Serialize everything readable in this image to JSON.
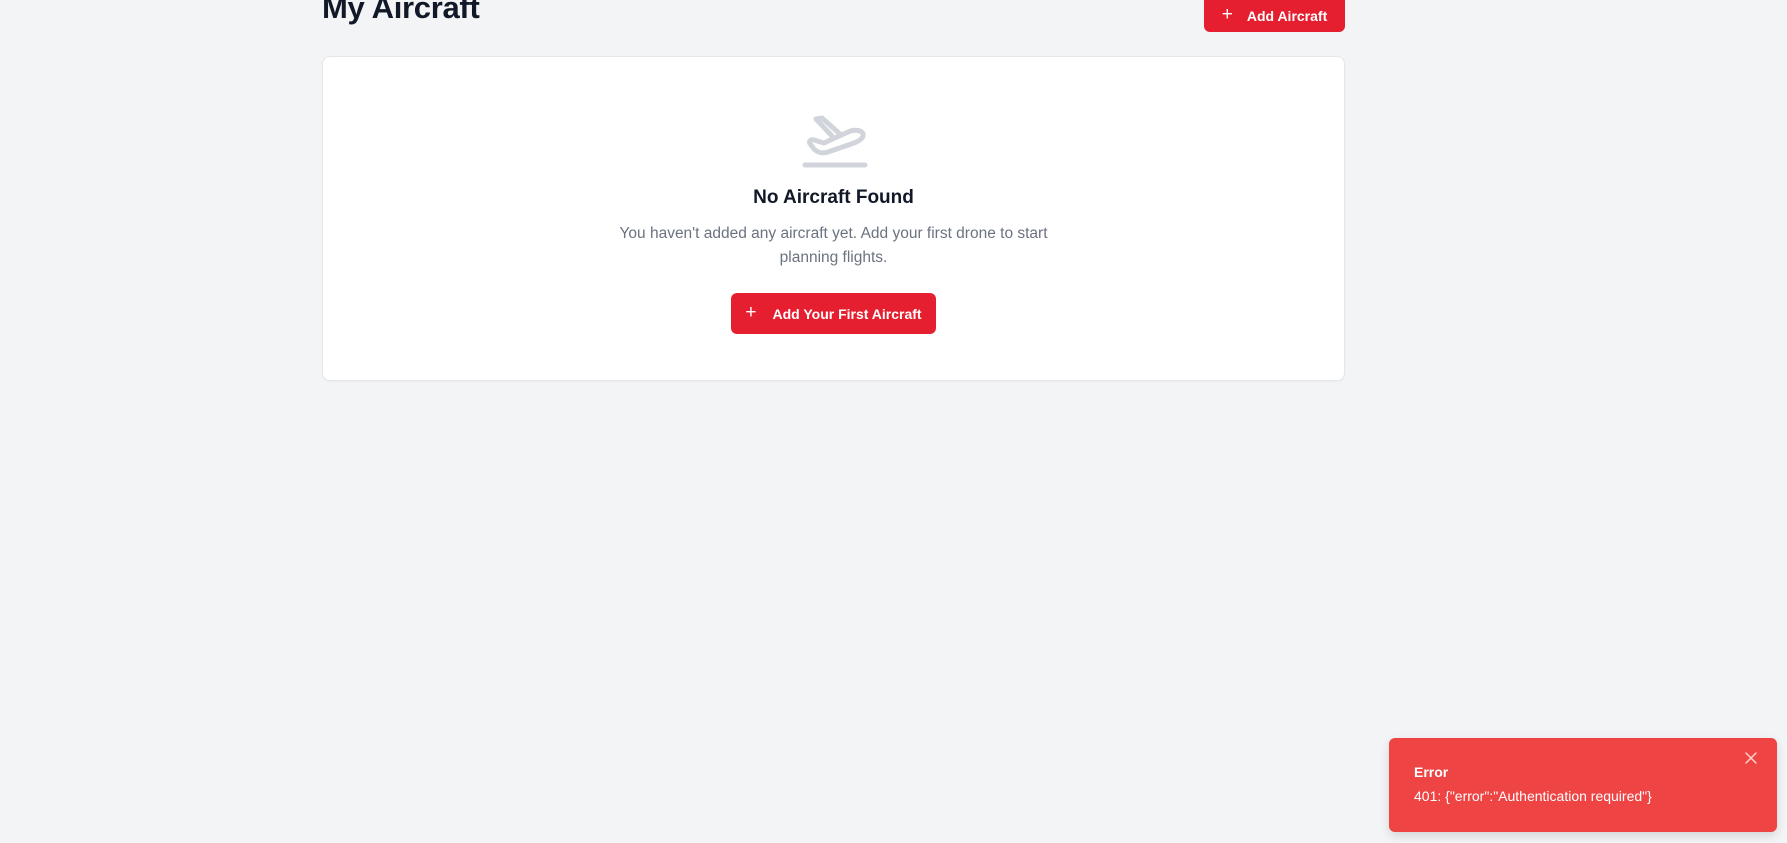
{
  "header": {
    "title": "My Aircraft",
    "add_button_label": "Add Aircraft",
    "add_button_icon": "plus-icon"
  },
  "empty_state": {
    "icon": "airplane-takeoff-icon",
    "title": "No Aircraft Found",
    "description": "You haven't added any aircraft yet. Add your first drone to start planning flights.",
    "button_label": "Add Your First Aircraft",
    "button_icon": "plus-icon"
  },
  "toast": {
    "title": "Error",
    "message": "401: {\"error\":\"Authentication required\"}",
    "close_icon": "close-icon"
  },
  "colors": {
    "accent": "#e51f2f",
    "background": "#f3f4f6",
    "toast_error": "#ef4444",
    "muted_text": "#6b7280",
    "icon_gray": "#d1d5db"
  }
}
